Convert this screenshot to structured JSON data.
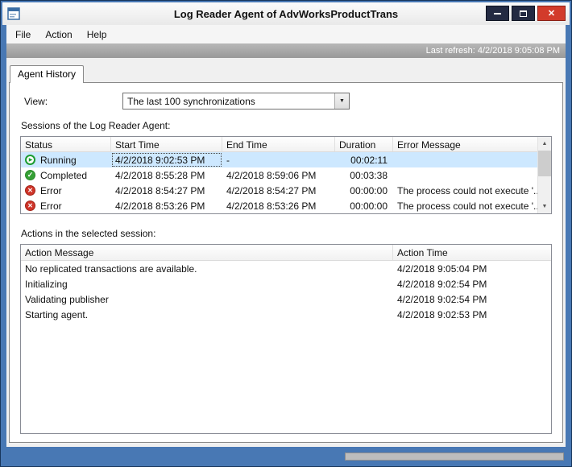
{
  "window": {
    "title": "Log Reader Agent of AdvWorksProductTrans",
    "menu": [
      "File",
      "Action",
      "Help"
    ],
    "last_refresh": "Last refresh: 4/2/2018 9:05:08 PM",
    "tab": "Agent History"
  },
  "view": {
    "label": "View:",
    "value": "The last 100 synchronizations"
  },
  "sessions": {
    "label": "Sessions of the Log Reader Agent:",
    "columns": [
      "Status",
      "Start Time",
      "End Time",
      "Duration",
      "Error Message"
    ],
    "rows": [
      {
        "icon": "running",
        "status": "Running",
        "start": "4/2/2018 9:02:53 PM",
        "end": "-",
        "duration": "00:02:11",
        "error": "",
        "selected": true,
        "focused": true
      },
      {
        "icon": "completed",
        "status": "Completed",
        "start": "4/2/2018 8:55:28 PM",
        "end": "4/2/2018 8:59:06 PM",
        "duration": "00:03:38",
        "error": ""
      },
      {
        "icon": "error",
        "status": "Error",
        "start": "4/2/2018 8:54:27 PM",
        "end": "4/2/2018 8:54:27 PM",
        "duration": "00:00:00",
        "error": "The process could not execute '..."
      },
      {
        "icon": "error",
        "status": "Error",
        "start": "4/2/2018 8:53:26 PM",
        "end": "4/2/2018 8:53:26 PM",
        "duration": "00:00:00",
        "error": "The process could not execute '..."
      }
    ]
  },
  "actions": {
    "label": "Actions in the selected session:",
    "columns": [
      "Action Message",
      "Action Time"
    ],
    "rows": [
      {
        "message": "No replicated transactions are available.",
        "time": "4/2/2018 9:05:04 PM"
      },
      {
        "message": "Initializing",
        "time": "4/2/2018 9:02:54 PM"
      },
      {
        "message": "Validating publisher",
        "time": "4/2/2018 9:02:54 PM"
      },
      {
        "message": "Starting agent.",
        "time": "4/2/2018 9:02:53 PM"
      }
    ]
  },
  "icons": {
    "running": "▶",
    "completed": "✓",
    "error": "✕",
    "dropdown": "▼",
    "scroll_up": "▲",
    "scroll_down": "▼",
    "close": "✕"
  },
  "colors": {
    "frame_blue": "#4878b4",
    "selection_blue": "#cde8ff",
    "running_green": "#1c9c31",
    "completed_green": "#35a035",
    "error_red": "#cf352a",
    "close_red": "#d23b2b",
    "refresh_bar_gray": "#a6a6a6"
  }
}
